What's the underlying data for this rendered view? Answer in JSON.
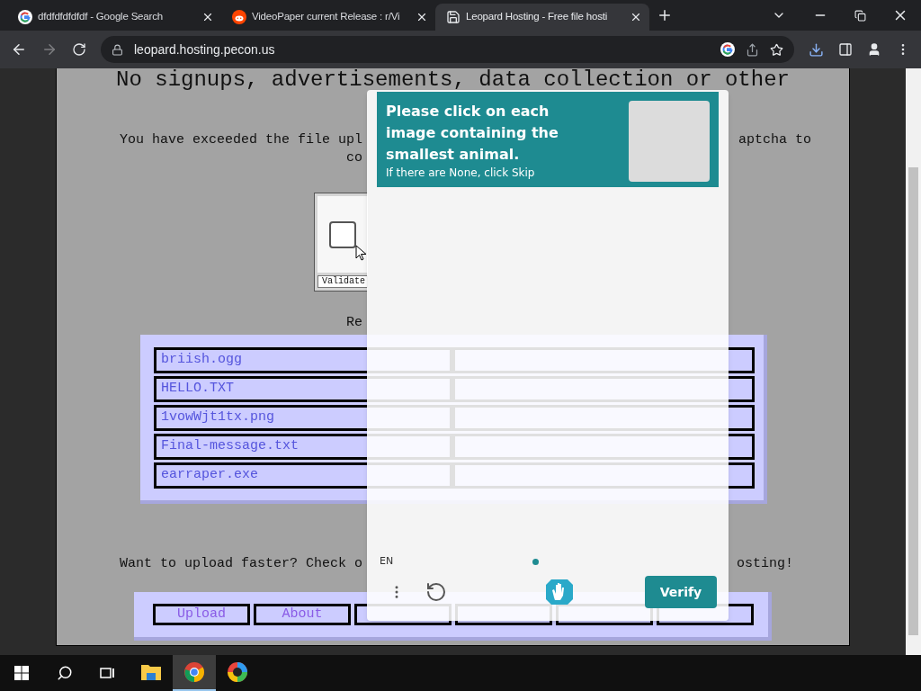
{
  "browser": {
    "tabs": [
      {
        "title": "dfdfdfdfdfdf - Google Search",
        "kind": "google",
        "selected": false
      },
      {
        "title": "VideoPaper current Release : r/Vi",
        "kind": "reddit",
        "selected": false
      },
      {
        "title": "Leopard Hosting - Free file hosti",
        "kind": "page",
        "selected": true
      }
    ],
    "address": "leopard.hosting.pecon.us"
  },
  "page": {
    "heading": "No signups, advertisements, data collection or other",
    "notice_left": "You have exceeded the file upl",
    "notice_right": "aptcha to",
    "notice_line2": "co",
    "checkbox_checked": false,
    "validate_button": "Validate",
    "recent_heading": "Re",
    "files": [
      "briish.ogg",
      "HELLO.TXT",
      "1vowWjt1tx.png",
      "Final-message.txt",
      "earraper.exe"
    ],
    "promo_left": "Want to upload faster? Check o",
    "promo_right": "osting!",
    "nav": [
      {
        "kind": "text",
        "label": "Upload"
      },
      {
        "kind": "text",
        "label": "About"
      },
      {
        "kind": "blank"
      },
      {
        "kind": "blank"
      },
      {
        "kind": "blank"
      },
      {
        "kind": "blank"
      }
    ]
  },
  "captcha": {
    "prompt": "Please click on each image containing the smallest animal.",
    "hint": "If there are None, click Skip",
    "language": "EN",
    "verify": "Verify"
  },
  "taskbar": {
    "apps": [
      {
        "kind": "folder",
        "selected": false
      },
      {
        "kind": "chrome",
        "selected": true
      },
      {
        "kind": "edge",
        "selected": false
      }
    ]
  }
}
